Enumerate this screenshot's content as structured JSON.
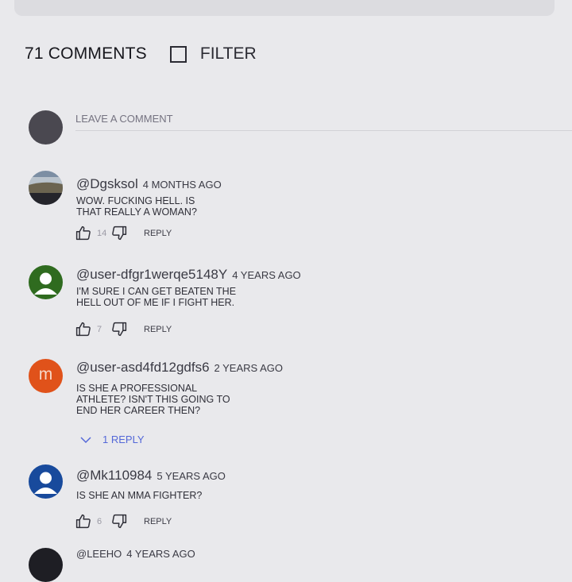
{
  "header": {
    "count_label": "71 COMMENTS",
    "filter_label": "FILTER"
  },
  "composer": {
    "placeholder": "LEAVE A COMMENT"
  },
  "comments": [
    {
      "author": "@Dgsksol",
      "time": "4 MONTHS AGO",
      "text": "WOW. FUCKING HELL. IS THAT REALLY A WOMAN?",
      "likes": "14",
      "reply_label": "REPLY",
      "avatar": "landscape-photo"
    },
    {
      "author": "@user-dfgr1werqe5148Y",
      "time": "4 YEARS AGO",
      "text": "I'M SURE I CAN GET BEATEN THE HELL OUT OF ME IF I FIGHT HER.",
      "likes": "7",
      "reply_label": "REPLY",
      "avatar": "default-user-green"
    },
    {
      "author": "@user-asd4fd12gdfs6",
      "time": "2 YEARS AGO",
      "text": "IS SHE A PROFESSIONAL ATHLETE? ISN'T THIS GOING TO END HER CAREER THEN?",
      "avatar_letter": "m",
      "replies_label": "1 REPLY"
    },
    {
      "author": "@Mk110984",
      "time": "5 YEARS AGO",
      "text": "IS SHE AN MMA FIGHTER?",
      "likes": "6",
      "reply_label": "REPLY",
      "avatar": "default-user-blue"
    },
    {
      "author": "@LEEHO",
      "time": "4 YEARS AGO"
    }
  ],
  "colors": {
    "background": "#e9e9ec",
    "accent": "#5468d8",
    "avatar_green": "#2f6b1f",
    "avatar_orange": "#e0521a",
    "avatar_blue": "#184a9c"
  }
}
